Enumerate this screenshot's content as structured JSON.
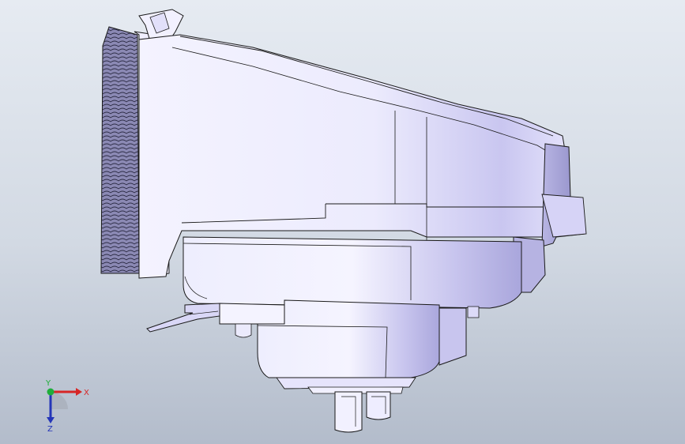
{
  "viewport": {
    "background_top": "#e6ebf2",
    "background_bottom": "#b3bccb"
  },
  "model": {
    "body_color": "#e9e7fb",
    "shade_color": "#c7c4ec",
    "edge_color": "#1a1a1a"
  },
  "triad": {
    "x_label": "X",
    "y_label": "Y",
    "z_label": "Z",
    "x_color": "#d72626",
    "y_color": "#1fae3a",
    "z_color": "#2435b8"
  }
}
